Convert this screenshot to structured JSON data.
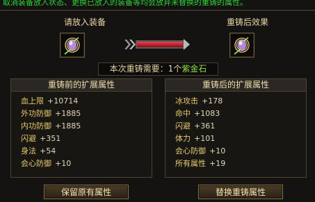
{
  "notice": "取消装备放入状态、更换已放入的装备等均会放弃未替换的重铸的属性。",
  "left_slot": {
    "label": "请放入装备",
    "icon": "purple-gem-ring-icon"
  },
  "right_slot": {
    "label": "重铸后效果",
    "icon": "purple-gem-ring-icon"
  },
  "cost": {
    "prefix": "本次重铸需要：",
    "count": "1个",
    "item": "紫金石"
  },
  "before": {
    "title": "重铸前的扩展属性",
    "attributes": [
      {
        "name": "血上限",
        "value": "+10714"
      },
      {
        "name": "外功防御",
        "value": "+1885"
      },
      {
        "name": "内功防御",
        "value": "+1885"
      },
      {
        "name": "闪避",
        "value": "+351"
      },
      {
        "name": "身法",
        "value": "+54"
      },
      {
        "name": "会心防御",
        "value": "+10"
      }
    ]
  },
  "after": {
    "title": "重铸后的扩展属性",
    "attributes": [
      {
        "name": "冰攻击",
        "value": "+178"
      },
      {
        "name": "命中",
        "value": "+1083"
      },
      {
        "name": "闪避",
        "value": "+361"
      },
      {
        "name": "体力",
        "value": "+101"
      },
      {
        "name": "会心防御",
        "value": "+10"
      },
      {
        "name": "所有属性",
        "value": "+19"
      }
    ]
  },
  "buttons": {
    "keep": "保留原有属性",
    "replace": "替换重铸属性"
  },
  "colors": {
    "notice": "#2fd33a",
    "attr_name": "#e7c96d",
    "gold_item": "#8fde46",
    "arrow": "#c41d2b"
  }
}
